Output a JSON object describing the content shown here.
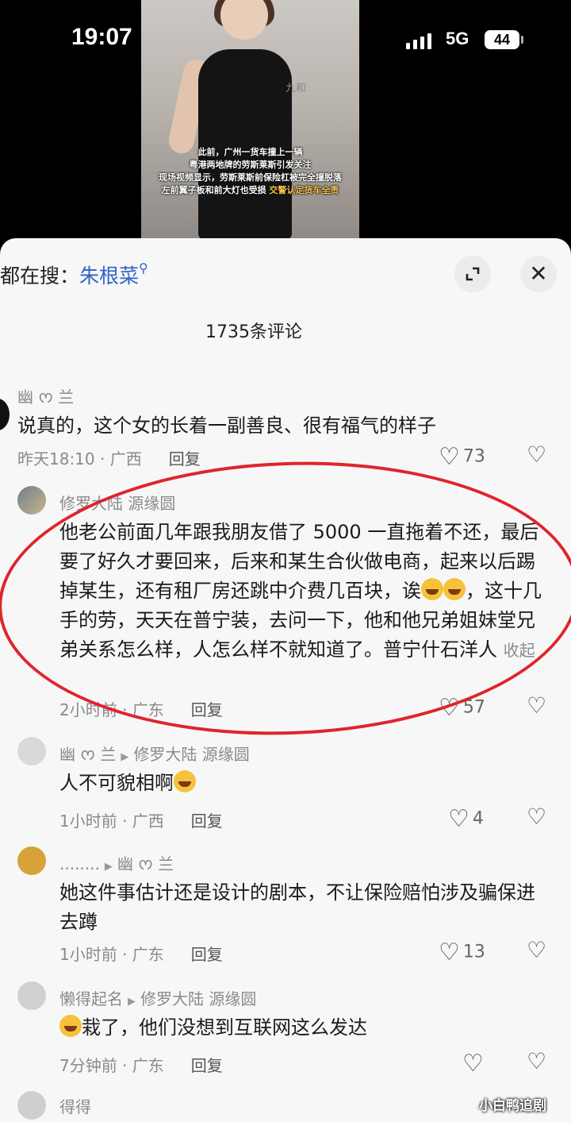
{
  "status_bar": {
    "time": "19:07",
    "network": "5G",
    "battery": "44"
  },
  "video": {
    "wall_logo": "九和",
    "caption_lines": [
      "此前，广州一货车撞上一辆",
      "粤港两地牌的劳斯莱斯引发关注",
      "现场视频显示，劳斯莱斯前保险杠被完全撞脱落",
      "左前翼子板和前大灯也受损"
    ],
    "caption_highlight": "交警认定货车全责"
  },
  "search": {
    "prefix": "都在搜：",
    "term": "朱根菜"
  },
  "comments_header": {
    "title": "1735条评论"
  },
  "comments": [
    {
      "user": "幽 ᰔ 兰",
      "reply_to": "",
      "text": "说真的，这个女的长着一副善良、很有福气的样子",
      "time": "昨天18:10 · 广西",
      "reply": "回复",
      "likes": "73"
    },
    {
      "user": "修罗大陆 源缘圆",
      "reply_to": "",
      "text_a": "他老公前面几年跟我朋友借了 5000 一直拖着不还，最后要了好久才要回来，后来和某生合伙做电商，起来以后踢掉某生，还有租厂房还跳中介费几百块，诶",
      "text_b": "，这十几手的劳，天天在普宁装，去问一下，他和他兄弟姐妹堂兄弟关系怎么样，人怎么样不就知道了。普宁什石洋人",
      "collapse": "收起",
      "time": "2小时前 · 广东",
      "reply": "回复",
      "likes": "57"
    },
    {
      "user": "幽 ᰔ 兰",
      "reply_to": "修罗大陆 源缘圆",
      "text": "人不可貌相啊",
      "time": "1小时前 · 广西",
      "reply": "回复",
      "likes": "4"
    },
    {
      "user": "........",
      "reply_to": "幽 ᰔ 兰",
      "text": "她这件事估计还是设计的剧本，不让保险赔怕涉及骗保进去蹲",
      "time": "1小时前 · 广东",
      "reply": "回复",
      "likes": "13"
    },
    {
      "user": "懒得起名",
      "reply_to": "修罗大陆 源缘圆",
      "text": "栽了，他们没想到互联网这么发达",
      "time": "7分钟前 · 广东",
      "reply": "回复",
      "likes": ""
    },
    {
      "user": "得得"
    }
  ],
  "watermark": "小白鸭追剧",
  "colors": {
    "annotation_oval": "#e0242b",
    "search_term": "#3262c4",
    "sheet_bg": "#f7f7f8"
  }
}
